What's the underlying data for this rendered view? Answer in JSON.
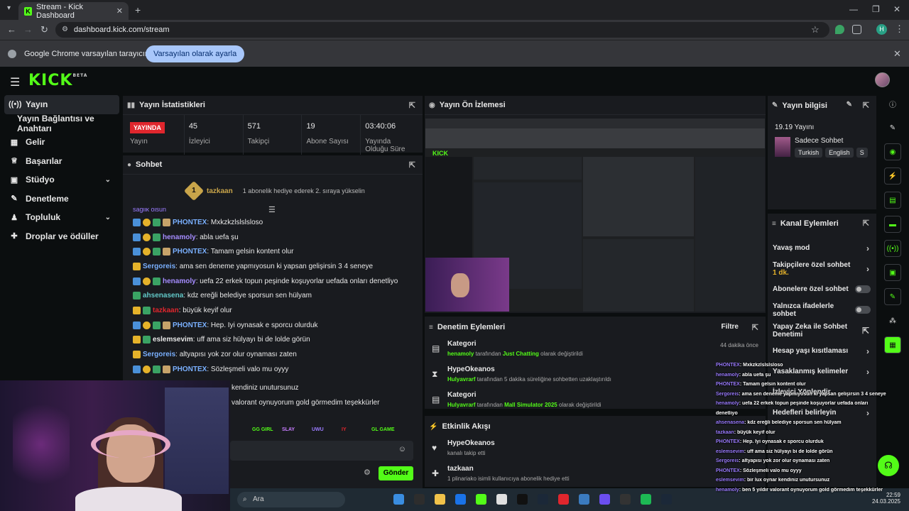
{
  "browser": {
    "tab_title": "Stream - Kick Dashboard",
    "url": "dashboard.kick.com/stream",
    "infobar_text": "Google Chrome varsayılan tarayıcınız değil",
    "infobar_button": "Varsayılan olarak ayarla",
    "profile_initial": "H"
  },
  "brand": {
    "logo": "KICK",
    "beta": "BETA",
    "accent": "#53fc18"
  },
  "sidebar": {
    "items": [
      {
        "label": "Yayın",
        "icon": "broadcast-icon",
        "active": true
      },
      {
        "label": "Yayın Bağlantısı ve Anahtarı",
        "sub": true
      },
      {
        "label": "Gelir",
        "icon": "wallet-icon"
      },
      {
        "label": "Başarılar",
        "icon": "trophy-icon"
      },
      {
        "label": "Stüdyo",
        "icon": "studio-icon",
        "chevron": true
      },
      {
        "label": "Denetleme",
        "icon": "wrench-icon"
      },
      {
        "label": "Topluluk",
        "icon": "community-icon",
        "chevron": true
      },
      {
        "label": "Droplar ve ödüller",
        "icon": "gift-icon"
      }
    ]
  },
  "stats_panel": {
    "title": "Yayın İstatistikleri",
    "stats": [
      {
        "badge": "YAYINDA",
        "label": "Yayın"
      },
      {
        "value": "45",
        "label": "İzleyici"
      },
      {
        "value": "571",
        "label": "Takipçi"
      },
      {
        "value": "19",
        "label": "Abone Sayısı"
      },
      {
        "value": "03:40:06",
        "label": "Yayında Olduğu Süre"
      }
    ]
  },
  "chat_panel": {
    "title": "Sohbet",
    "pinned": {
      "user": "tazkaan",
      "rank": "1",
      "message": "1 abonelik hediye ederek 2. sıraya yükselin"
    },
    "top_partial": "saglik olsun",
    "messages": [
      {
        "user": "PHONTEX",
        "color": "#7ab0ff",
        "badges": [
          "b-blue",
          "b-gold",
          "b-green",
          "b-tan"
        ],
        "text": ": Mxkzkzlslslsloso"
      },
      {
        "user": "henamoly",
        "color": "#a58cff",
        "badges": [
          "b-blue",
          "b-gold",
          "b-green"
        ],
        "text": ": abla uefa şu"
      },
      {
        "user": "PHONTEX",
        "color": "#7ab0ff",
        "badges": [
          "b-blue",
          "b-gold",
          "b-green",
          "b-tan"
        ],
        "text": ": Tamam gelsin kontent olur"
      },
      {
        "user": "Sergoreis",
        "color": "#7ab0ff",
        "badges": [
          "b-crown"
        ],
        "text": ": ama sen deneme yapmıyosun ki yapsan gelişirsin 3 4 seneye"
      },
      {
        "user": "henamoly",
        "color": "#a58cff",
        "badges": [
          "b-blue",
          "b-gold",
          "b-green"
        ],
        "text": ": uefa 22 erkek topun peşinde koşuyorlar uefada onları denetliyo"
      },
      {
        "user": "ahsenasena",
        "color": "#62c8c8",
        "badges": [
          "b-green"
        ],
        "text": ": kdz ereğli belediye sporsun sen hülyam"
      },
      {
        "user": "tazkaan",
        "color": "#e0262d",
        "badges": [
          "b-crown",
          "b-green"
        ],
        "text": ": büyük keyif olur"
      },
      {
        "user": "PHONTEX",
        "color": "#7ab0ff",
        "badges": [
          "b-blue",
          "b-gold",
          "b-green",
          "b-tan"
        ],
        "text": ": Hep. Iyi oynasak e sporcu olurduk"
      },
      {
        "user": "eslemsevim",
        "color": "#e8e8e8",
        "badges": [
          "b-crown",
          "b-green"
        ],
        "text": ": uff ama siz hülyayı bi de lolde görün"
      },
      {
        "user": "Sergoreis",
        "color": "#7ab0ff",
        "badges": [
          "b-crown"
        ],
        "text": ": altyapısı yok zor olur oynaması zaten"
      },
      {
        "user": "PHONTEX",
        "color": "#7ab0ff",
        "badges": [
          "b-blue",
          "b-gold",
          "b-green",
          "b-tan"
        ],
        "text": ": Sözleşmeli valo mu oyyy"
      }
    ],
    "partial_lines": [
      "kendiniz unutursunuz",
      "valorant oynuyorum gold görmedim teşekkürler"
    ],
    "emotes": [
      "GG GIRL",
      "SLAY",
      "UWU",
      "IY",
      "GL GAME"
    ],
    "send_label": "Gönder"
  },
  "preview_panel": {
    "title": "Yayın Ön İzlemesi"
  },
  "moderation_panel": {
    "title": "Denetim Eylemleri",
    "filter_label": "Filtre",
    "events": [
      {
        "title": "Kategori",
        "actor": "henamoly",
        "mid": " tarafından ",
        "target": "Just Chatting",
        "rest": " olarak değiştirildi",
        "ago": "44 dakika önce",
        "icon": "category-icon"
      },
      {
        "title": "HypeOkeanos",
        "actor": "Hulyavrarf",
        "mid": " tarafından 5 dakika süreliğine sohbetten uzaklaştırıldı",
        "target": "",
        "rest": "",
        "ago": "",
        "icon": "hourglass-icon"
      },
      {
        "title": "Kategori",
        "actor": "Hulyavrarf",
        "mid": " tarafından ",
        "target": "Mall Simulator 2025",
        "rest": " olarak değiştirildi",
        "ago": "",
        "icon": "category-icon"
      }
    ]
  },
  "activity_panel": {
    "title": "Etkinlik Akışı",
    "events": [
      {
        "title": "HypeOkeanos",
        "desc": "kanalı takip etti",
        "icon": "heart-icon"
      },
      {
        "title": "tazkaan",
        "desc": "1 plinariako isimli kullanıcıya abonelik hediye etti",
        "icon": "gift-icon"
      }
    ]
  },
  "info_panel": {
    "title": "Yayın bilgisi",
    "stream_title": "19.19 Yayını",
    "category": "Sadece Sohbet",
    "tags": [
      "Turkish",
      "English",
      "S"
    ]
  },
  "channel_actions": {
    "title": "Kanal Eylemleri",
    "items": [
      {
        "label": "Yavaş mod",
        "type": "arrow"
      },
      {
        "label": "Takipçilere özel sohbet",
        "sub": "1 dk.",
        "type": "arrow"
      },
      {
        "label": "Abonelere özel sohbet",
        "type": "toggle"
      },
      {
        "label": "Yalnızca ifadelerle sohbet",
        "type": "toggle"
      },
      {
        "label": "Yapay Zeka ile Sohbet Denetimi",
        "type": "external"
      },
      {
        "label": "Hesap yaşı kısıtlaması",
        "type": "arrow"
      },
      {
        "label": "Yasaklanmış kelimeler",
        "type": "arrow"
      },
      {
        "label": "İzleyici Yönlendir",
        "type": "none"
      },
      {
        "label": "Hedefleri belirleyin",
        "type": "arrow"
      }
    ]
  },
  "overlay_chat": [
    {
      "user": "PHONTEX",
      "text": ": Mxkzkzlslslsloso"
    },
    {
      "user": "henamoly",
      "text": ": abla uefa şu"
    },
    {
      "user": "PHONTEX",
      "text": ": Tamam gelsin kontent olur"
    },
    {
      "user": "Sergoreis",
      "text": ": ama sen deneme yapmıyosun ki yapsan gelişirsin 3 4 seneye"
    },
    {
      "user": "henamoly",
      "text": ": uefa 22 erkek topun peşinde koşuyorlar uefada onları"
    },
    {
      "user": "",
      "text": "denetliyo"
    },
    {
      "user": "ahsenasena",
      "text": ": kdz ereğli belediye sporsun sen hülyam"
    },
    {
      "user": "tazkaan",
      "text": ": büyük keyif olur"
    },
    {
      "user": "PHONTEX",
      "text": ": Hep. Iyi oynasak e sporcu olurduk"
    },
    {
      "user": "eslemsevim",
      "text": ": uff ama siz hülyayı bi de lolde görün"
    },
    {
      "user": "Sergoreis",
      "text": ": altyapısı yok zor olur oynaması zaten"
    },
    {
      "user": "PHONTEX",
      "text": ": Sözleşmeli valo mu oyyy"
    },
    {
      "user": "eslemsevim",
      "text": ": bir lux oynar kendiniz unutursunuz"
    },
    {
      "user": "henamoly",
      "text": ": ben 5 yıldır valorant oynuyorum gold görmedim teşekkürler"
    }
  ],
  "taskbar": {
    "search_placeholder": "Ara",
    "time": "22:59",
    "date": "24.03.2025"
  }
}
